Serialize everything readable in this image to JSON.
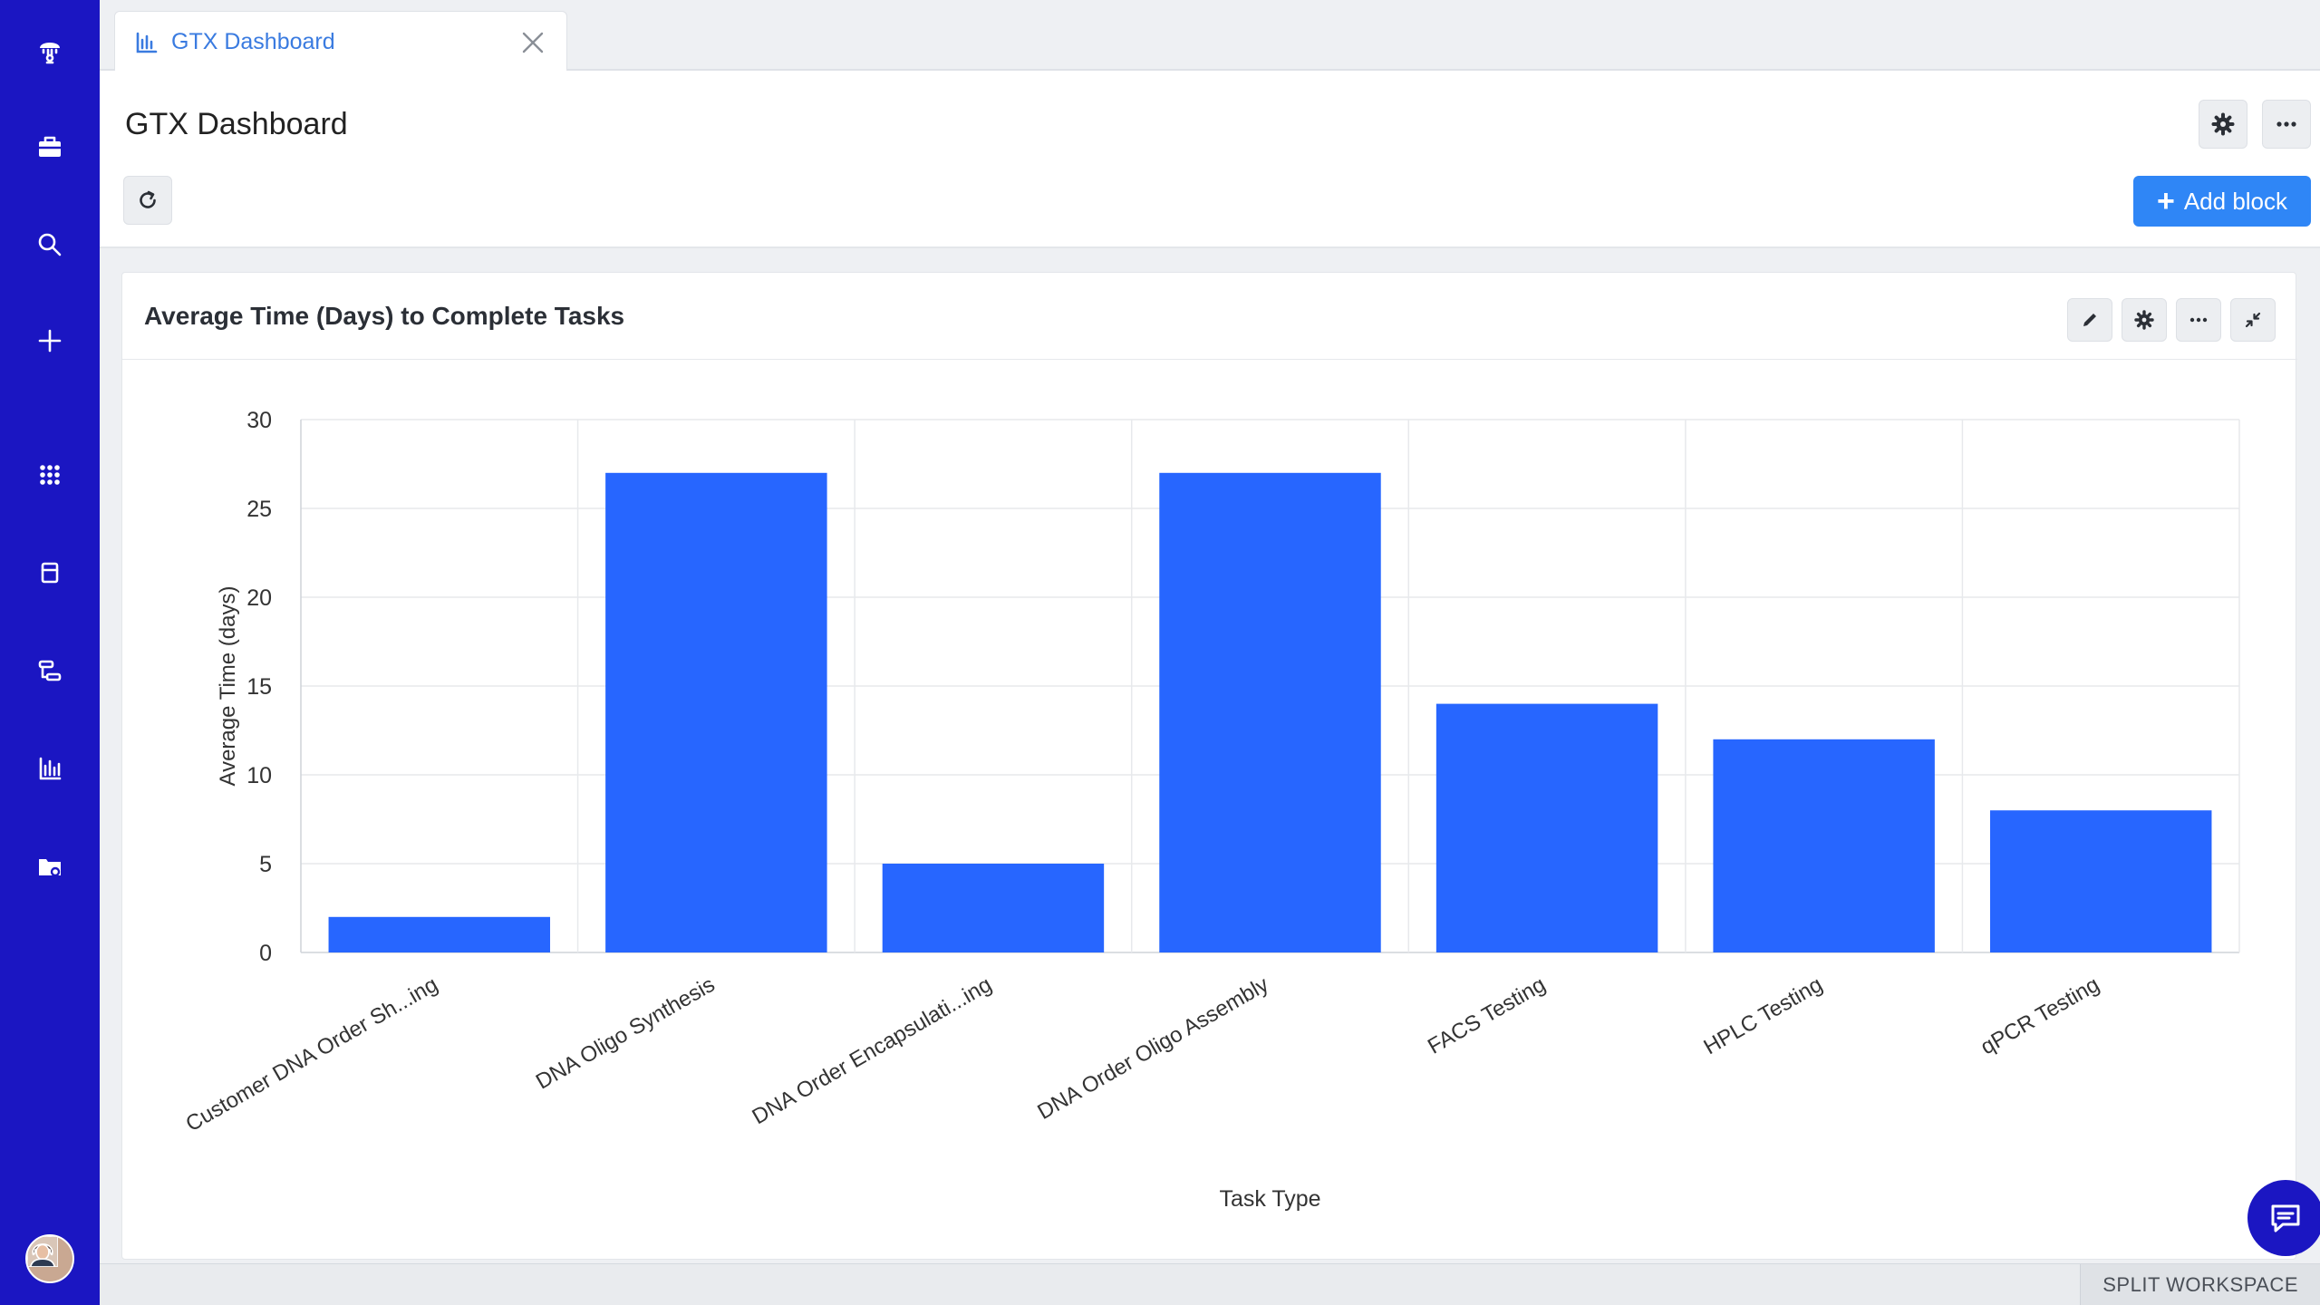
{
  "tab": {
    "label": "GTX Dashboard",
    "icon": "bar-chart-icon"
  },
  "header": {
    "title": "GTX Dashboard",
    "add_block_label": "Add block"
  },
  "card": {
    "title": "Average Time (Days) to Complete Tasks"
  },
  "footer": {
    "split_workspace_label": "SPLIT WORKSPACE"
  },
  "colors": {
    "rail": "#1b16c2",
    "bar": "#2766ff",
    "accent": "#2f86f6"
  },
  "chart_data": {
    "type": "bar",
    "title": "",
    "xlabel": "Task Type",
    "ylabel": "Average Time (days)",
    "ylim": [
      0,
      30
    ],
    "yticks": [
      0,
      5,
      10,
      15,
      20,
      25,
      30
    ],
    "grid": true,
    "categories": [
      "Customer DNA Order Sh...ing",
      "DNA Oligo Synthesis",
      "DNA Order Encapsulati...ing",
      "DNA Order Oligo Assembly",
      "FACS Testing",
      "HPLC Testing",
      "qPCR Testing"
    ],
    "values": [
      2,
      27,
      5,
      27,
      14,
      12,
      8
    ]
  }
}
